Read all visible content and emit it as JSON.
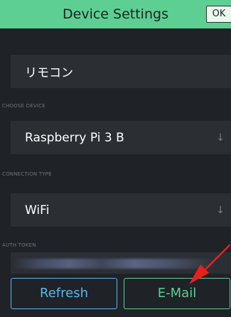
{
  "header": {
    "title": "Device Settings",
    "ok_label": "OK"
  },
  "project": {
    "name": "リモコン"
  },
  "device": {
    "section_label": "CHOOSE DEVICE",
    "value": "Raspberry Pi 3 B",
    "chevron": "↓"
  },
  "connection": {
    "section_label": "CONNECTION TYPE",
    "value": "WiFi",
    "chevron": "↓"
  },
  "auth": {
    "section_label": "AUTH TOKEN"
  },
  "buttons": {
    "refresh_label": "Refresh",
    "email_label": "E-Mail"
  },
  "colors": {
    "header_bg": "#5ecf93",
    "background": "#1f2226",
    "field_bg": "#2b2f34",
    "refresh_accent": "#5ab7ee",
    "email_accent": "#5ecf93",
    "annotation_arrow": "#e8201c"
  }
}
